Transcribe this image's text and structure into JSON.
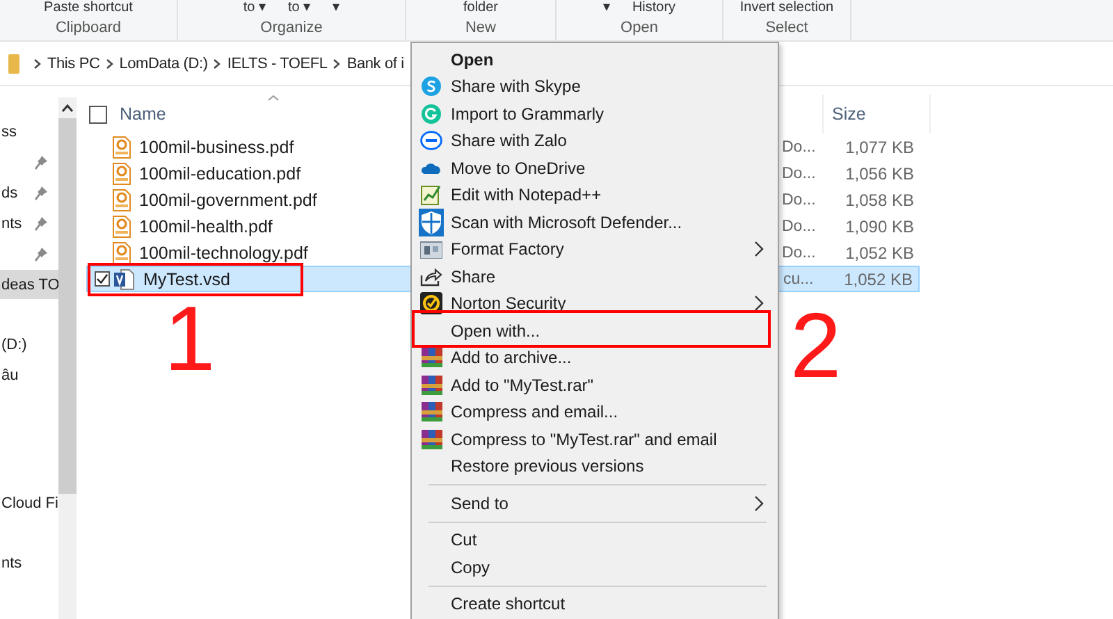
{
  "ribbon": {
    "groups": [
      {
        "label": "Clipboard",
        "items": [
          "Paste shortcut"
        ]
      },
      {
        "label": "Organize",
        "items": [
          "to ▾",
          "to ▾",
          "▾"
        ]
      },
      {
        "label": "New",
        "items": [
          "folder"
        ]
      },
      {
        "label": "Open",
        "items": [
          "▾",
          "History"
        ]
      },
      {
        "label": "Select",
        "items": [
          "Invert selection"
        ]
      }
    ]
  },
  "address_bar": {
    "path": [
      "This PC",
      "LomData (D:)",
      "IELTS - TOEFL",
      "Bank of i"
    ]
  },
  "sidebar": {
    "items": [
      {
        "label": "ss",
        "pinned": false,
        "selected": false
      },
      {
        "pinned": true,
        "selected": false
      },
      {
        "label": "ds",
        "pinned": true,
        "selected": false
      },
      {
        "label": "nts",
        "pinned": true,
        "selected": false
      },
      {
        "pinned": true,
        "selected": false
      },
      {
        "label": "deas TO",
        "pinned": false,
        "selected": true
      },
      {
        "label": "(D:)",
        "pinned": false,
        "selected": false
      },
      {
        "label": "âu",
        "pinned": false,
        "selected": false
      },
      {
        "label": "Cloud Fi",
        "pinned": false,
        "selected": false
      },
      {
        "label": "nts",
        "pinned": false,
        "selected": false
      }
    ]
  },
  "file_list": {
    "columns": [
      "Name",
      "Size"
    ],
    "all_checked": false,
    "rows": [
      {
        "name": "100mil-business.pdf",
        "type": "Do...",
        "size": "1,077 KB",
        "kind": "pdf",
        "selected": false,
        "checked": false
      },
      {
        "name": "100mil-education.pdf",
        "type": "Do...",
        "size": "1,056 KB",
        "kind": "pdf",
        "selected": false,
        "checked": false
      },
      {
        "name": "100mil-government.pdf",
        "type": "Do...",
        "size": "1,058 KB",
        "kind": "pdf",
        "selected": false,
        "checked": false
      },
      {
        "name": "100mil-health.pdf",
        "type": "Do...",
        "size": "1,090 KB",
        "kind": "pdf",
        "selected": false,
        "checked": false
      },
      {
        "name": "100mil-technology.pdf",
        "type": "Do...",
        "size": "1,052 KB",
        "kind": "pdf",
        "selected": false,
        "checked": false
      },
      {
        "name": "MyTest.vsd",
        "type": "cu...",
        "size": "1,052 KB",
        "kind": "vsd",
        "selected": true,
        "checked": true
      }
    ]
  },
  "context_menu": {
    "items": [
      {
        "kind": "item",
        "label": "Open",
        "bold": true,
        "submenu": false
      },
      {
        "kind": "item",
        "label": "Share with Skype",
        "bold": false,
        "submenu": false
      },
      {
        "kind": "item",
        "label": "Import to Grammarly",
        "bold": false,
        "submenu": false
      },
      {
        "kind": "item",
        "label": "Share with Zalo",
        "bold": false,
        "submenu": false
      },
      {
        "kind": "item",
        "label": "Move to OneDrive",
        "bold": false,
        "submenu": false
      },
      {
        "kind": "item",
        "label": "Edit with Notepad++",
        "bold": false,
        "submenu": false
      },
      {
        "kind": "item",
        "label": "Scan with Microsoft Defender...",
        "bold": false,
        "submenu": false
      },
      {
        "kind": "item",
        "label": "Format Factory",
        "bold": false,
        "submenu": true
      },
      {
        "kind": "item",
        "label": "Share",
        "bold": false,
        "submenu": false
      },
      {
        "kind": "item",
        "label": "Norton Security",
        "bold": false,
        "submenu": true
      },
      {
        "kind": "item",
        "label": "Open with...",
        "bold": false,
        "submenu": false
      },
      {
        "kind": "item",
        "label": "Add to archive...",
        "bold": false,
        "submenu": false
      },
      {
        "kind": "item",
        "label": "Add to \"MyTest.rar\"",
        "bold": false,
        "submenu": false
      },
      {
        "kind": "item",
        "label": "Compress and email...",
        "bold": false,
        "submenu": false
      },
      {
        "kind": "item",
        "label": "Compress to \"MyTest.rar\" and email",
        "bold": false,
        "submenu": false
      },
      {
        "kind": "item",
        "label": "Restore previous versions",
        "bold": false,
        "submenu": false
      },
      {
        "kind": "separator"
      },
      {
        "kind": "item",
        "label": "Send to",
        "bold": false,
        "submenu": true
      },
      {
        "kind": "separator"
      },
      {
        "kind": "item",
        "label": "Cut",
        "bold": false,
        "submenu": false
      },
      {
        "kind": "item",
        "label": "Copy",
        "bold": false,
        "submenu": false
      },
      {
        "kind": "separator"
      },
      {
        "kind": "item",
        "label": "Create shortcut",
        "bold": false,
        "submenu": false
      }
    ]
  },
  "annotations": [
    {
      "label": "1"
    },
    {
      "label": "2"
    }
  ]
}
